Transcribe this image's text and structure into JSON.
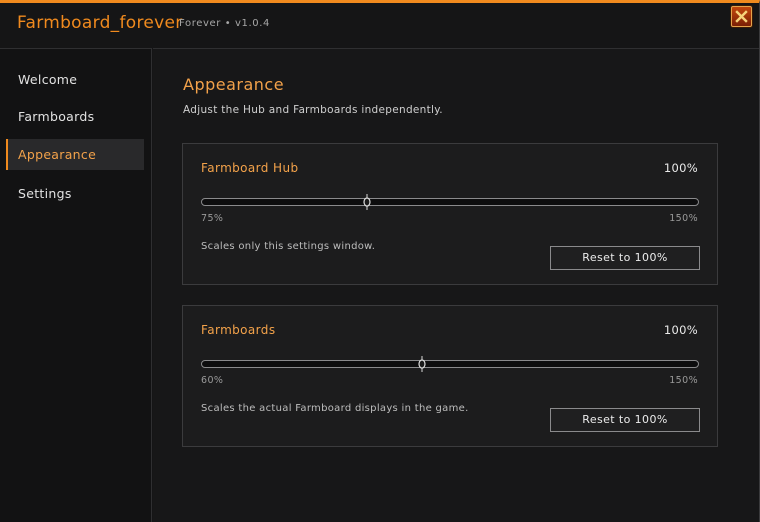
{
  "app": {
    "title": "Farmboard_forever",
    "version": "Forever • v1.0.4",
    "close_icon": "close-x-icon",
    "accent_color": "#f08a1e"
  },
  "sidebar": {
    "items": [
      {
        "label": "Welcome",
        "active": false
      },
      {
        "label": "Farmboards",
        "active": false
      },
      {
        "label": "Appearance",
        "active": true
      },
      {
        "label": "Settings",
        "active": false
      }
    ]
  },
  "main": {
    "title": "Appearance",
    "subtitle": "Adjust the Hub and Farmboards independently.",
    "hub": {
      "title": "Farmboard Hub",
      "value_label": "100%",
      "min_label": "75%",
      "max_label": "150%",
      "min": 75,
      "max": 150,
      "value": 100,
      "note": "Scales only this settings window.",
      "reset_label": "Reset to 100%"
    },
    "farmboards": {
      "title": "Farmboards",
      "value_label": "100%",
      "min_label": "60%",
      "max_label": "150%",
      "min": 60,
      "max": 150,
      "value": 100,
      "note": "Scales the actual Farmboard displays in the game.",
      "reset_label": "Reset to 100%"
    }
  }
}
